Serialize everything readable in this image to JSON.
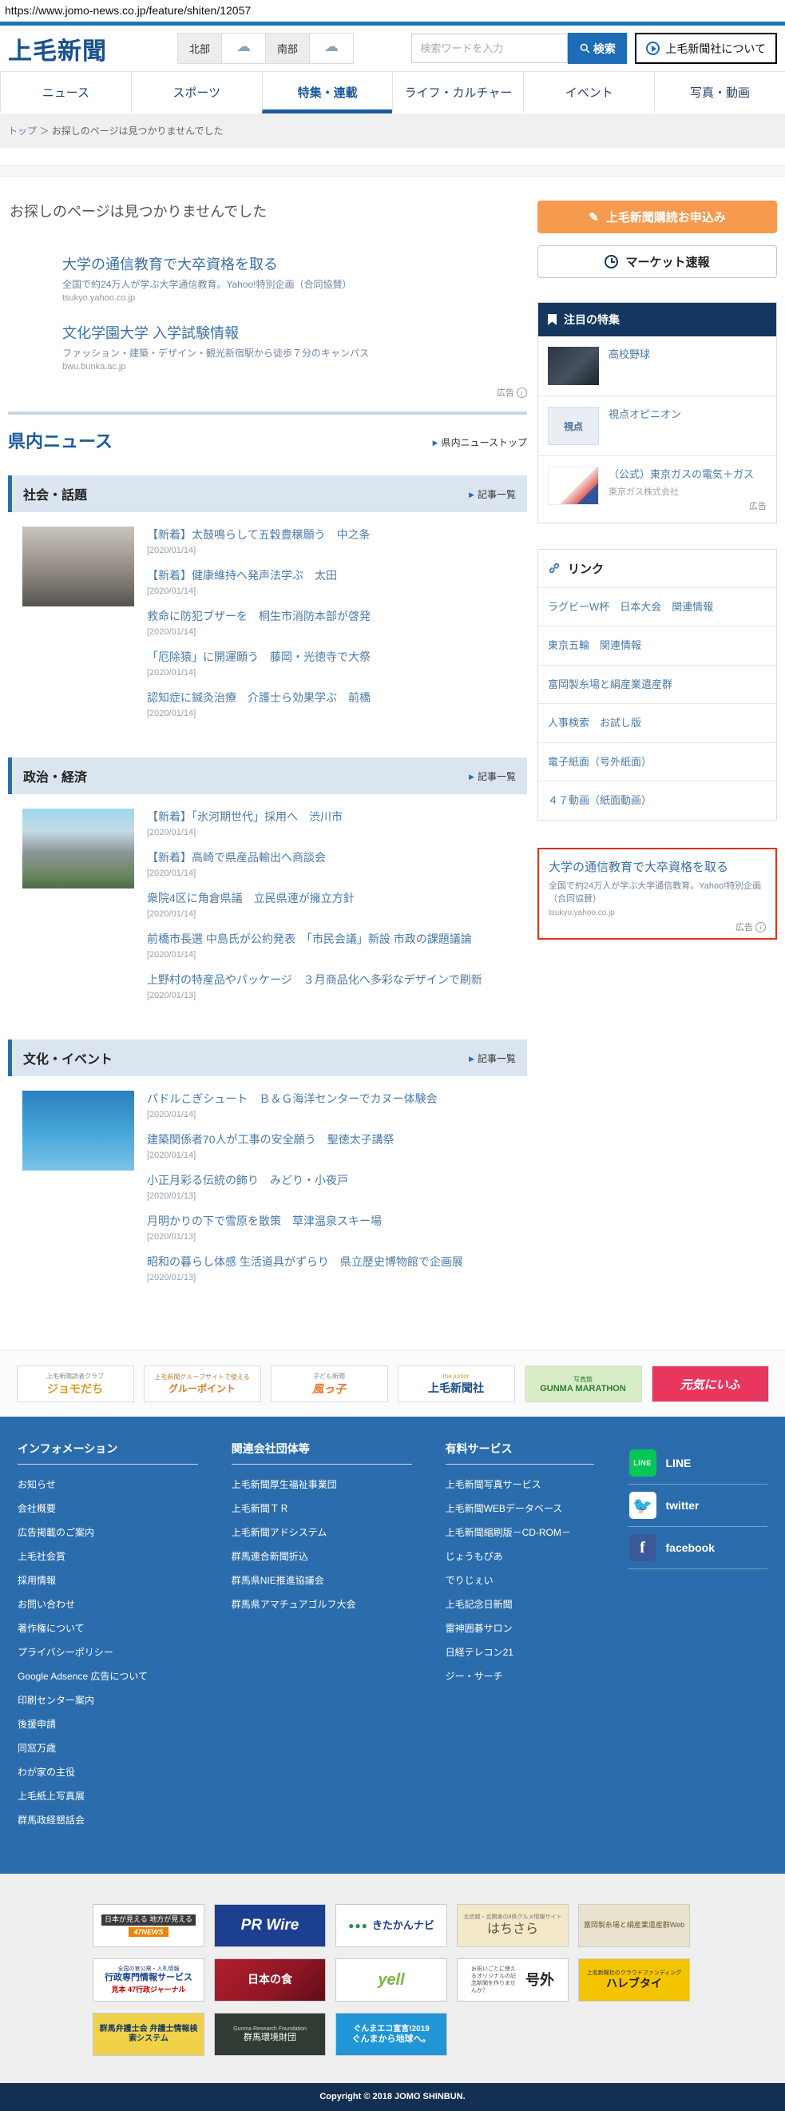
{
  "url_bar": "https://www.jomo-news.co.jp/feature/shiten/12057",
  "header": {
    "logo": "上毛新聞",
    "weather": {
      "north_label": "北部",
      "south_label": "南部",
      "icon": "☁"
    },
    "search": {
      "placeholder": "検索ワードを入力",
      "button_label": "検索"
    },
    "about_label": "上毛新聞社について"
  },
  "nav": {
    "items": [
      {
        "label": "ニュース"
      },
      {
        "label": "スポーツ"
      },
      {
        "label": "特集・連載",
        "state": "active"
      },
      {
        "label": "ライフ・カルチャー"
      },
      {
        "label": "イベント"
      },
      {
        "label": "写真・動画"
      }
    ]
  },
  "breadcrumb": {
    "home": "トップ",
    "separator": "＞",
    "current": "お探しのページは見つかりませんでした"
  },
  "main": {
    "not_found": "お探しのページは見つかりませんでした",
    "ads": [
      {
        "title": "大学の通信教育で大卒資格を取る",
        "desc": "全国で約24万人が学ぶ大学通信教育。Yahoo!特別企画（合同協賛）",
        "url": "tsukyo.yahoo.co.jp"
      },
      {
        "title": "文化学園大学 入学試験情報",
        "desc": "ファッション・建築・デザイン・観光新宿駅から徒歩７分のキャンパス",
        "url": "bwu.bunka.ac.jp"
      }
    ],
    "ad_label": "広告",
    "kennai": {
      "title": "県内ニュース",
      "top_link": "県内ニューストップ",
      "more_label": "記事一覧",
      "sections": {
        "society": {
          "title": "社会・話題",
          "items": [
            {
              "title": "【新着】太鼓鳴らして五穀豊穣願う　中之条",
              "date": "[2020/01/14]"
            },
            {
              "title": "【新着】健康維持へ発声法学ぶ　太田",
              "date": "[2020/01/14]"
            },
            {
              "title": "救命に防犯ブザーを　桐生市消防本部が啓発",
              "date": "[2020/01/14]"
            },
            {
              "title": "「厄除猿」に開運願う　藤岡・光徳寺で大祭",
              "date": "[2020/01/14]"
            },
            {
              "title": "認知症に鍼灸治療　介護士ら効果学ぶ　前橋",
              "date": "[2020/01/14]"
            }
          ]
        },
        "politics": {
          "title": "政治・経済",
          "items": [
            {
              "title": "【新着】「氷河期世代」採用へ　渋川市",
              "date": "[2020/01/14]"
            },
            {
              "title": "【新着】高崎で県産品輸出へ商談会",
              "date": "[2020/01/14]"
            },
            {
              "title": "衆院4区に角倉県議　立民県連が擁立方針",
              "date": "[2020/01/14]"
            },
            {
              "title": "前橋市長選 中島氏が公約発表　「市民会議」新設 市政の課題議論",
              "date": "[2020/01/14]"
            },
            {
              "title": "上野村の特産品やパッケージ　３月商品化へ多彩なデザインで刷新",
              "date": "[2020/01/13]"
            }
          ]
        },
        "culture": {
          "title": "文化・イベント",
          "items": [
            {
              "title": "パドルこぎシュート　Ｂ＆Ｇ海洋センターでカヌー体験会",
              "date": "[2020/01/14]"
            },
            {
              "title": "建築関係者70人が工事の安全願う　聖徳太子講祭",
              "date": "[2020/01/14]"
            },
            {
              "title": "小正月彩る伝統の飾り　みどり・小夜戸",
              "date": "[2020/01/13]"
            },
            {
              "title": "月明かりの下で雪原を散策　草津温泉スキー場",
              "date": "[2020/01/13]"
            },
            {
              "title": "昭和の暮らし体感 生活道具がずらり　県立歴史博物館で企画展",
              "date": "[2020/01/13]"
            }
          ]
        }
      }
    }
  },
  "sidebar": {
    "subscribe_label": "上毛新聞購読お申込み",
    "market_label": "マーケット速報",
    "featured": {
      "title": "注目の特集",
      "items": [
        {
          "label": "高校野球",
          "thumb": "thumb-baseball",
          "thumb_text": "",
          "sub": "",
          "ad": ""
        },
        {
          "label": "視点オピニオン",
          "thumb": "thumb-shiten",
          "thumb_text": "視点",
          "sub": "",
          "ad": ""
        },
        {
          "label": "（公式）東京ガスの電気＋ガス",
          "thumb": "thumb-gas",
          "thumb_text": "",
          "sub": "東京ガス株式会社",
          "ad": "広告"
        }
      ]
    },
    "links": {
      "title": "リンク",
      "items": [
        "ラグビーW杯　日本大会　関連情報",
        "東京五輪　関連情報",
        "富岡製糸場と絹産業遺産群",
        "人事検索　お試し版",
        "電子紙面（号外紙面）",
        "４７動画（紙面動画）"
      ]
    },
    "side_ad": {
      "title": "大学の通信教育で大卒資格を取る",
      "desc": "全国で約24万人が学ぶ大学通信教育。Yahoo!特別企画（合同協賛）",
      "url": "tsukyo.yahoo.co.jp",
      "ad_label": "広告"
    }
  },
  "partner_strip": [
    {
      "cls": "pb-jomo",
      "sub": "上毛新聞読者クラブ",
      "name": "ジョモだち"
    },
    {
      "cls": "pb-point",
      "sub": "上毛新聞グループサイトで使える",
      "name": "グルーポイント"
    },
    {
      "cls": "pb-kazakko",
      "sub": "子ども新聞",
      "name": "風っ子"
    },
    {
      "cls": "pb-shimbunsha",
      "sub": "the junior",
      "name": "上毛新聞社"
    },
    {
      "cls": "pb-marathon",
      "sub": "写真館",
      "name": "GUNMA MARATHON"
    },
    {
      "cls": "pb-genki",
      "sub": "",
      "name": "元気にいふ"
    }
  ],
  "footer": {
    "info": {
      "title": "インフォメーション",
      "links": [
        "お知らせ",
        "会社概要",
        "広告掲載のご案内",
        "上毛社会賞",
        "採用情報",
        "お問い合わせ",
        "著作権について",
        "プライバシーポリシー",
        "Google Adsence 広告について",
        "印刷センター案内",
        "後援申請",
        "同窓万歳",
        "わが家の主役",
        "上毛紙上写真展",
        "群馬政経懇話会"
      ]
    },
    "related": {
      "title": "関連会社団体等",
      "links": [
        "上毛新聞厚生福祉事業団",
        "上毛新聞ＴＲ",
        "上毛新聞アドシステム",
        "群馬連合新聞折込",
        "群馬県NIE推進協議会",
        "群馬県アマチュアゴルフ大会"
      ]
    },
    "paid": {
      "title": "有料サービス",
      "links": [
        "上毛新聞写真サービス",
        "上毛新聞WEBデータベース",
        "上毛新聞縮刷版－CD-ROM－",
        "じょうもぴあ",
        "でりじぇい",
        "上毛記念日新聞",
        "雷神囲碁サロン",
        "日経テレコン21",
        "ジー・サーチ"
      ]
    },
    "social": [
      {
        "label": "LINE",
        "cls": "icon-line",
        "glyph": "LINE"
      },
      {
        "label": "twitter",
        "cls": "icon-twitter",
        "glyph": "🐦"
      },
      {
        "label": "facebook",
        "cls": "icon-facebook",
        "glyph": "f"
      }
    ]
  },
  "logo_grid": {
    "row1": [
      {
        "cls": "lb-47",
        "name": "日本が見える 地方が見える",
        "sub": "",
        "badge": "47NEWS"
      },
      {
        "cls": "lb-prwire",
        "name": "PR Wire",
        "sub": "",
        "badge": ""
      },
      {
        "cls": "lb-kitakan",
        "name": "きたかんナビ",
        "sub": "",
        "badge": "●●●"
      },
      {
        "cls": "lb-hachisara",
        "name": "はちさら",
        "sub": "北信越・北関東の8県グルメ情報サイト",
        "badge": ""
      },
      {
        "cls": "lb-tomioka",
        "name": "富岡製糸場と絹産業遺産群Web",
        "sub": "",
        "badge": ""
      }
    ],
    "row2": [
      {
        "cls": "lb-gyosei",
        "name": "行政専門情報サービス",
        "sub": "全国の官公需・入札情報",
        "badge": "見本 47行政ジャーナル"
      },
      {
        "cls": "lb-nihon",
        "name": "日本の食",
        "sub": "",
        "badge": ""
      },
      {
        "cls": "lb-yell",
        "name": "yell",
        "sub": "",
        "badge": ""
      },
      {
        "cls": "lb-gogai",
        "name": "号外",
        "sub": "お祝いごとに使えるオリジナルの記念新聞を作りませんか？",
        "badge": ""
      },
      {
        "cls": "lb-harebutai",
        "name": "ハレブタイ",
        "sub": "上毛新聞社のクラウドファンディング",
        "badge": ""
      }
    ],
    "row3": [
      {
        "cls": "lb-bengoshi",
        "name": "群馬弁護士会 弁護士情報検索システム",
        "sub": "",
        "badge": ""
      },
      {
        "cls": "lb-kankyo",
        "name": "群馬環境財団",
        "sub": "Gunma Research Foundation",
        "badge": ""
      },
      {
        "cls": "lb-eco",
        "name": "ぐんまから地球へ。",
        "sub": "ぐんまエコ宣言!2019",
        "badge": ""
      }
    ]
  },
  "copyright": "Copyright © 2018 JOMO SHINBUN."
}
